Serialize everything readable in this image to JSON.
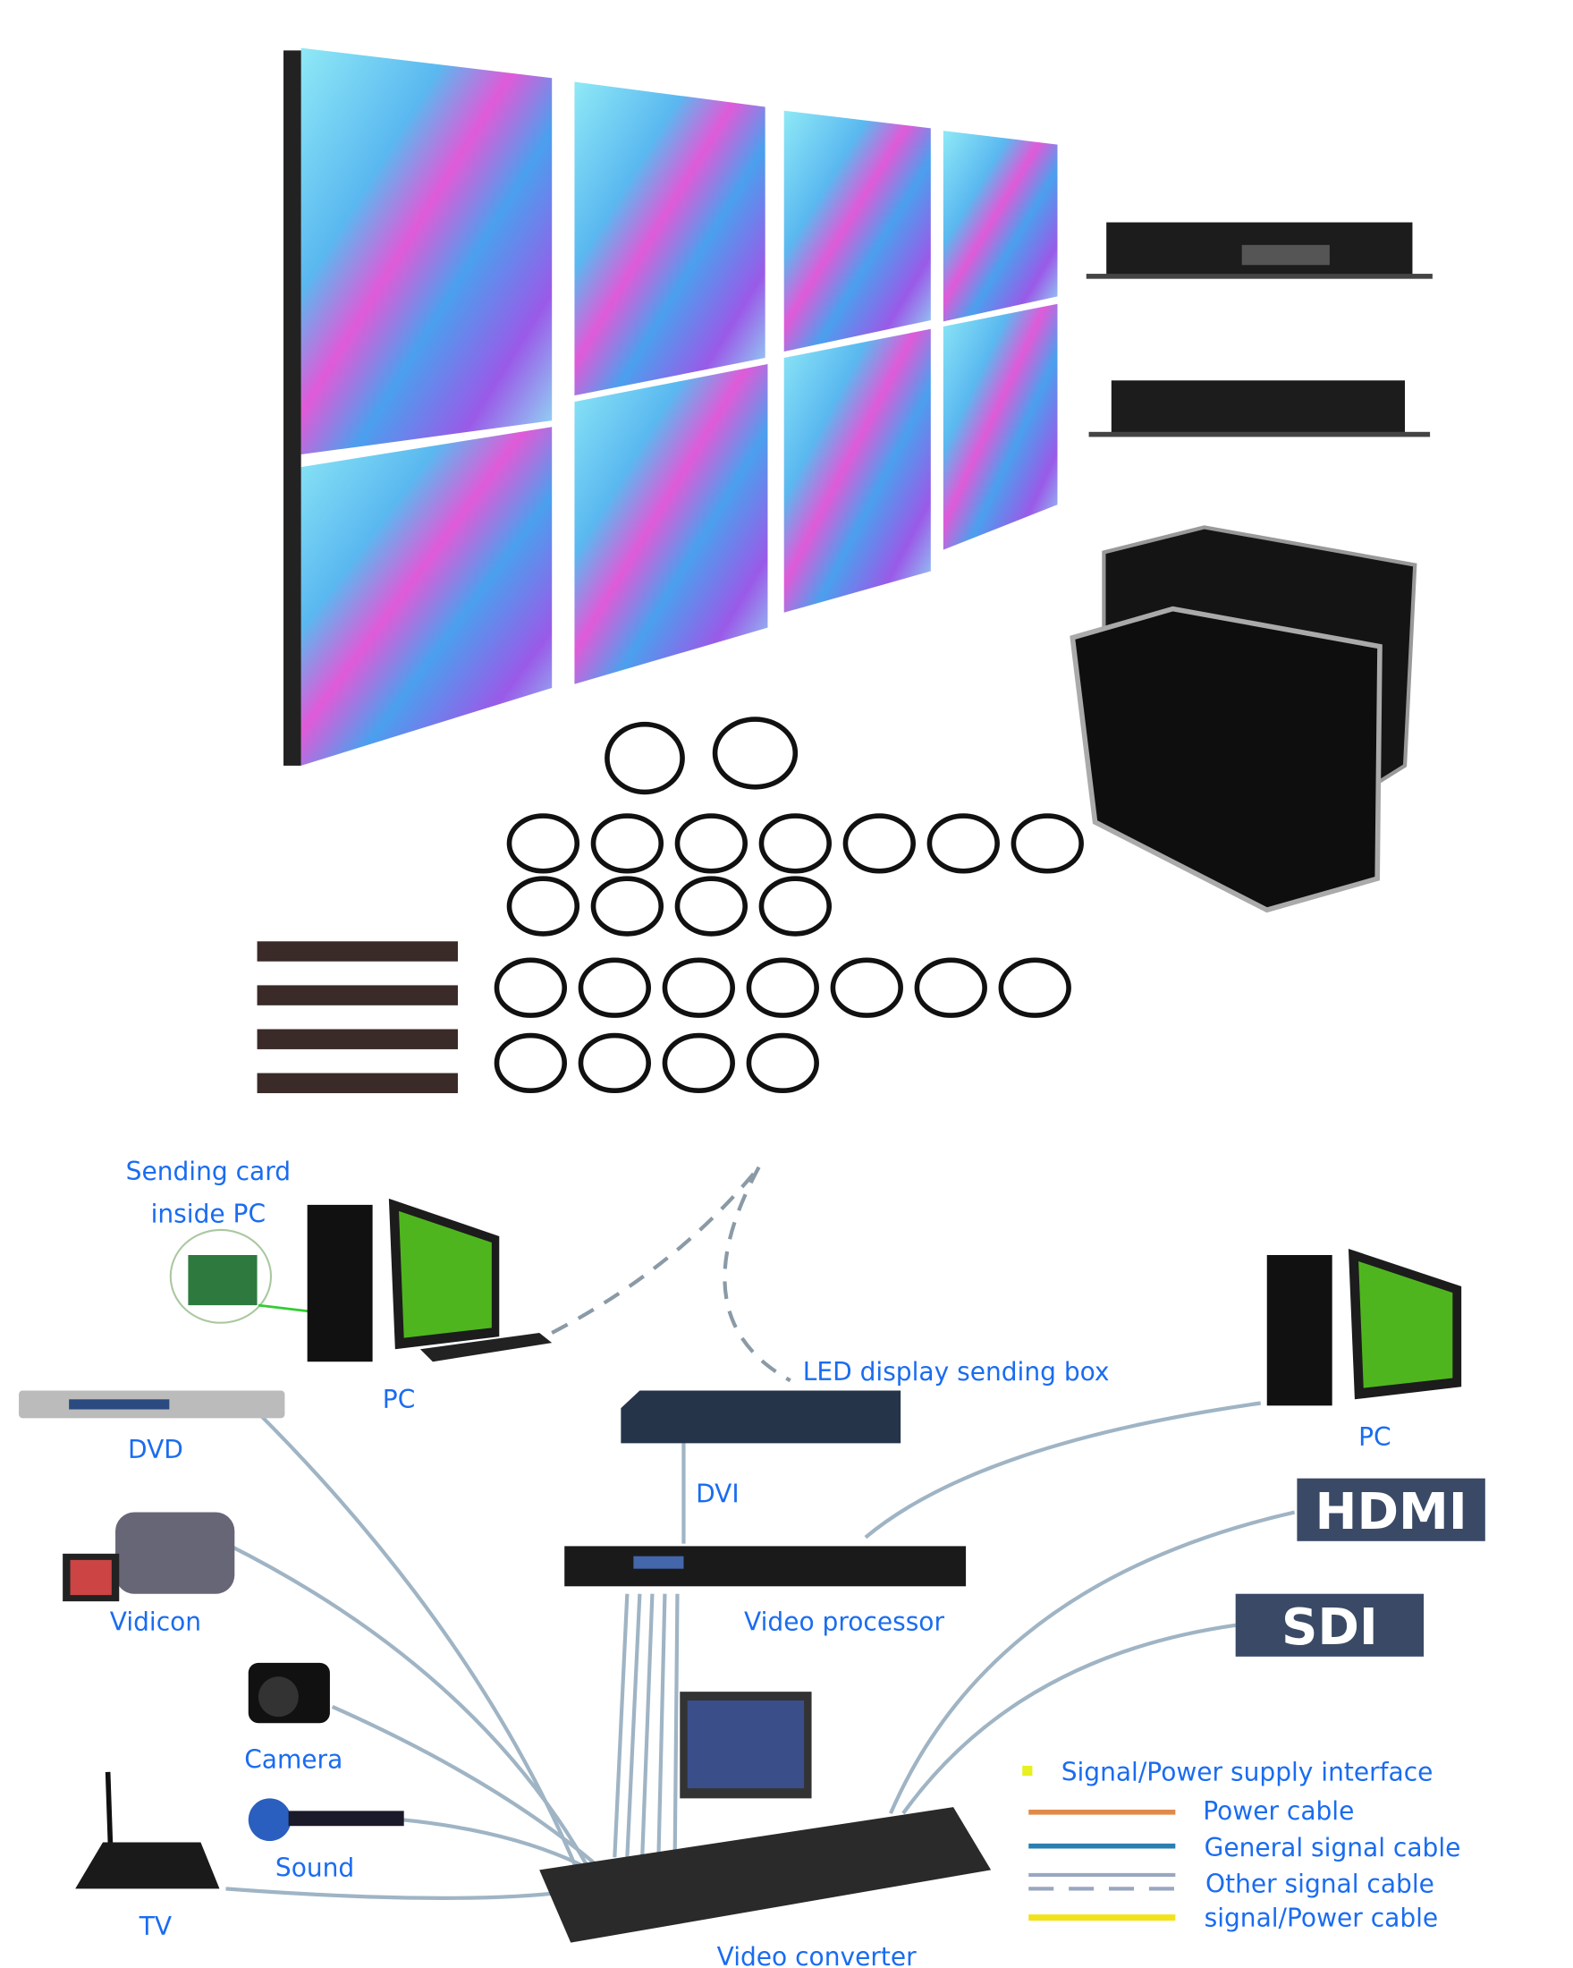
{
  "diagram": {
    "labels": {
      "sending_card_line1": "Sending card",
      "sending_card_line2": "inside PC",
      "pc_left": "PC",
      "dvd": "DVD",
      "sending_box": "LED display sending box",
      "dvi": "DVI",
      "pc_right": "PC",
      "hdmi": "HDMI",
      "sdi": "SDI",
      "vidicon": "Vidicon",
      "video_processor": "Video processor",
      "camera": "Camera",
      "sound": "Sound",
      "tv": "TV",
      "video_converter": "Video converter"
    },
    "legend": [
      {
        "label": "Signal/Power supply interface",
        "color": "#e8f020"
      },
      {
        "label": "Power cable",
        "color": "#e08a4a"
      },
      {
        "label": "General signal cable",
        "color": "#2a7fb0"
      },
      {
        "label": "Other signal cable",
        "color": "#9aa6c0"
      },
      {
        "label": "signal/Power cable",
        "color": "#f2e21a"
      }
    ],
    "colors": {
      "text": "#1a6cf0",
      "cable": "#9fb4c4",
      "badge": "#3a4a66"
    }
  }
}
